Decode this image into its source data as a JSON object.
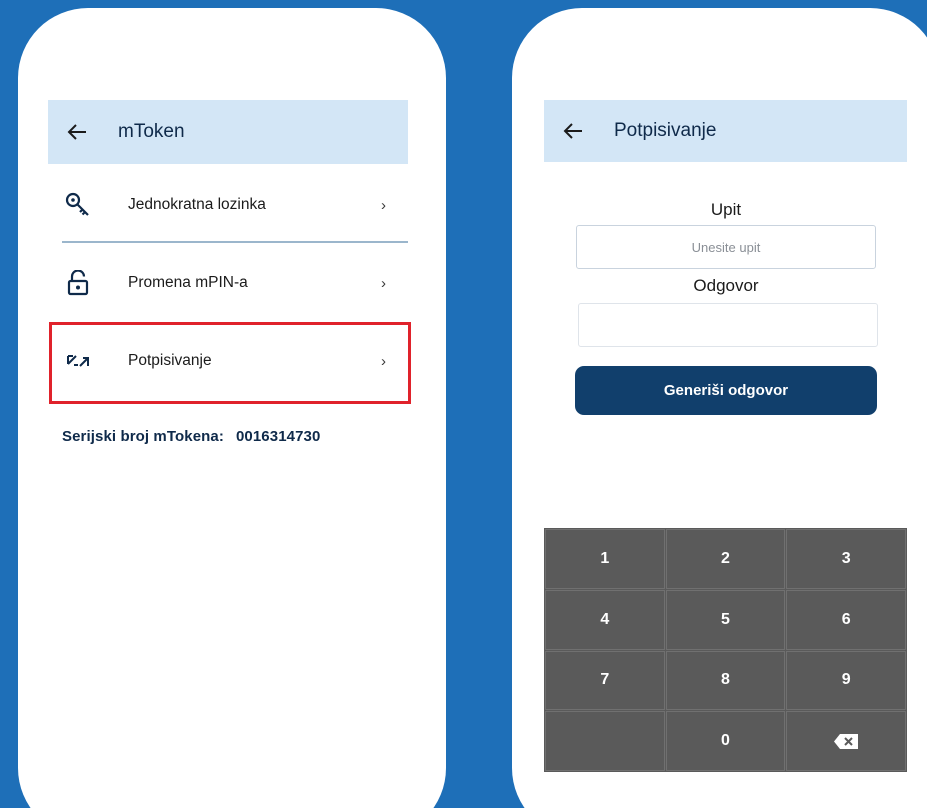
{
  "left_screen": {
    "appbar": {
      "title": "mToken"
    },
    "menu": [
      {
        "label": "Jednokratna lozinka",
        "icon": "key-icon"
      },
      {
        "label": "Promena mPIN-a",
        "icon": "unlock-icon"
      },
      {
        "label": "Potpisivanje",
        "icon": "sign-arrows-icon"
      }
    ],
    "chevron": "›",
    "serial": {
      "label": "Serijski broj mTokena:",
      "value": "0016314730"
    },
    "highlight_color": "#e0222b"
  },
  "right_screen": {
    "appbar": {
      "title": "Potpisivanje"
    },
    "query": {
      "label": "Upit",
      "placeholder": "Unesite upit",
      "value": ""
    },
    "answer": {
      "label": "Odgovor",
      "value": ""
    },
    "generate_button": "Generiši odgovor",
    "keypad": {
      "keys": [
        "1",
        "2",
        "3",
        "4",
        "5",
        "6",
        "7",
        "8",
        "9",
        "",
        "0",
        "⌫"
      ]
    }
  },
  "colors": {
    "background": "#1e6fb8",
    "appbar": "#d3e6f6",
    "primary": "#113f6c",
    "keypad": "#5a5a5a"
  }
}
